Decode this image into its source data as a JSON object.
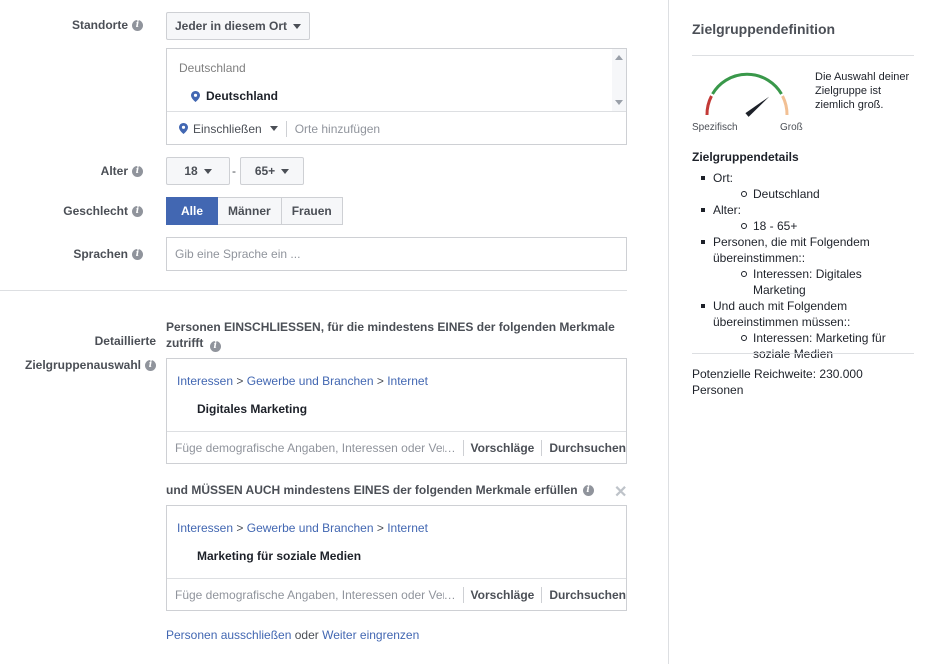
{
  "labels": {
    "locations": "Standorte",
    "age": "Alter",
    "gender": "Geschlecht",
    "languages": "Sprachen",
    "detailed_line1": "Detaillierte",
    "detailed_line2": "Zielgruppenauswahl"
  },
  "location": {
    "dropdown": "Jeder in diesem Ort",
    "country_header": "Deutschland",
    "selected": "Deutschland",
    "include_label": "Einschließen",
    "add_placeholder": "Orte hinzufügen"
  },
  "age": {
    "min": "18",
    "dash": "-",
    "max": "65+"
  },
  "gender": {
    "all": "Alle",
    "men": "Männer",
    "women": "Frauen",
    "selected": "Alle"
  },
  "languages": {
    "placeholder": "Gib eine Sprache ein ..."
  },
  "detailed": {
    "include_text": "Personen EINSCHLIESSEN, für die mindestens EINES der folgenden Merkmale zutrifft",
    "must_text": "und MÜSSEN AUCH mindestens EINES der folgenden Merkmale erfüllen",
    "box1": {
      "crumb1": "Interessen",
      "crumb2": "Gewerbe und Branchen",
      "crumb3": "Internet",
      "item": "Digitales Marketing"
    },
    "box2": {
      "crumb1": "Interessen",
      "crumb2": "Gewerbe und Branchen",
      "crumb3": "Internet",
      "item": "Marketing für soziale Medien"
    },
    "search_placeholder": "Füge demografische Angaben, Interessen oder Verhaltensweisen hinzu",
    "suggestions": "Vorschläge",
    "browse": "Durchsuchen",
    "exclude_link": "Personen ausschließen",
    "or": " oder ",
    "narrow_link": "Weiter eingrenzen",
    "close_glyph": "✕"
  },
  "sidebar": {
    "title": "Zielgruppendefinition",
    "gauge_desc": "Die Auswahl deiner Zielgruppe ist ziemlich groß.",
    "gauge_left": "Spezifisch",
    "gauge_right": "Groß",
    "gauge_level": 0.78,
    "details_title": "Zielgruppendetails",
    "items": [
      {
        "label": "Ort:",
        "sub": "Deutschland"
      },
      {
        "label": "Alter:",
        "sub": "18 - 65+"
      },
      {
        "label": "Personen, die mit Folgendem übereinstimmen::",
        "sub": "Interessen: Digitales Marketing"
      },
      {
        "label": "Und auch mit Folgendem übereinstimmen müssen::",
        "sub": "Interessen: Marketing für soziale Medien"
      }
    ],
    "reach": "Potenzielle Reichweite: 230.000 Personen"
  },
  "colors": {
    "accent": "#4267b2",
    "gauge_red": "#c33a37",
    "gauge_green": "#39984a",
    "gauge_orange": "#f2c094"
  }
}
